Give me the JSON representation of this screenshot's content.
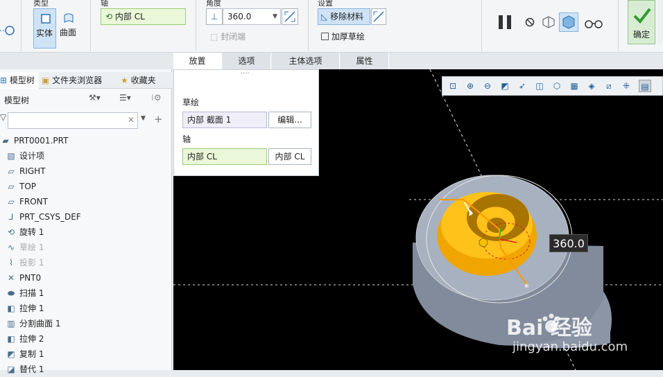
{
  "ribbon": {
    "type_group": {
      "title": "类型",
      "solid": "实体",
      "surface": "曲面"
    },
    "axis_group": {
      "title": "轴",
      "value": "内部 CL"
    },
    "angle_group": {
      "title": "角度",
      "value": "360.0",
      "close_ends": "封闭端"
    },
    "settings_group": {
      "title": "设置",
      "remove_material": "移除材料",
      "thicken_sketch": "加厚草绘"
    },
    "ok": "确定"
  },
  "tabs": [
    "放置",
    "选项",
    "主体选项",
    "属性"
  ],
  "left_panel": {
    "tabs": [
      "模型树",
      "文件夹浏览器",
      "收藏夹"
    ],
    "section_title": "模型树",
    "search_placeholder": "",
    "items": [
      {
        "label": "PRT0001.PRT",
        "icon": "part-icon",
        "dim": false
      },
      {
        "label": "设计项",
        "icon": "design-item-icon",
        "dim": false
      },
      {
        "label": "RIGHT",
        "icon": "plane-icon",
        "dim": false
      },
      {
        "label": "TOP",
        "icon": "plane-icon",
        "dim": false
      },
      {
        "label": "FRONT",
        "icon": "plane-icon",
        "dim": false
      },
      {
        "label": "PRT_CSYS_DEF",
        "icon": "csys-icon",
        "dim": false
      },
      {
        "label": "旋转 1",
        "icon": "revolve-icon",
        "dim": false
      },
      {
        "label": "草绘 1",
        "icon": "sketch-icon",
        "dim": true
      },
      {
        "label": "投影 1",
        "icon": "projection-icon",
        "dim": true
      },
      {
        "label": "PNT0",
        "icon": "point-icon",
        "dim": false
      },
      {
        "label": "扫描 1",
        "icon": "sweep-icon",
        "dim": false
      },
      {
        "label": "拉伸 1",
        "icon": "extrude-icon",
        "dim": false
      },
      {
        "label": "分割曲面 1",
        "icon": "split-surface-icon",
        "dim": false
      },
      {
        "label": "拉伸 2",
        "icon": "extrude-icon",
        "dim": false
      },
      {
        "label": "复制 1",
        "icon": "copy-icon",
        "dim": false
      },
      {
        "label": "替代 1",
        "icon": "substitute-icon",
        "dim": false
      }
    ]
  },
  "placement": {
    "sketch_label": "草绘",
    "sketch_value": "内部 截面 1",
    "edit_button": "编辑...",
    "axis_label": "轴",
    "axis_value": "内部 CL",
    "axis_button": "内部 CL"
  },
  "viewport": {
    "angle_label": "360.0",
    "watermark_main": "Bai  经验",
    "watermark_url": "jingyan.baidu.com"
  },
  "colors": {
    "ribbon_bg": "#f3f5f7",
    "viewport_bg": "#000000",
    "model_gray": "#8e98a8",
    "interior_orange": "#f0a500",
    "accent_green": "#2e9b2e"
  }
}
